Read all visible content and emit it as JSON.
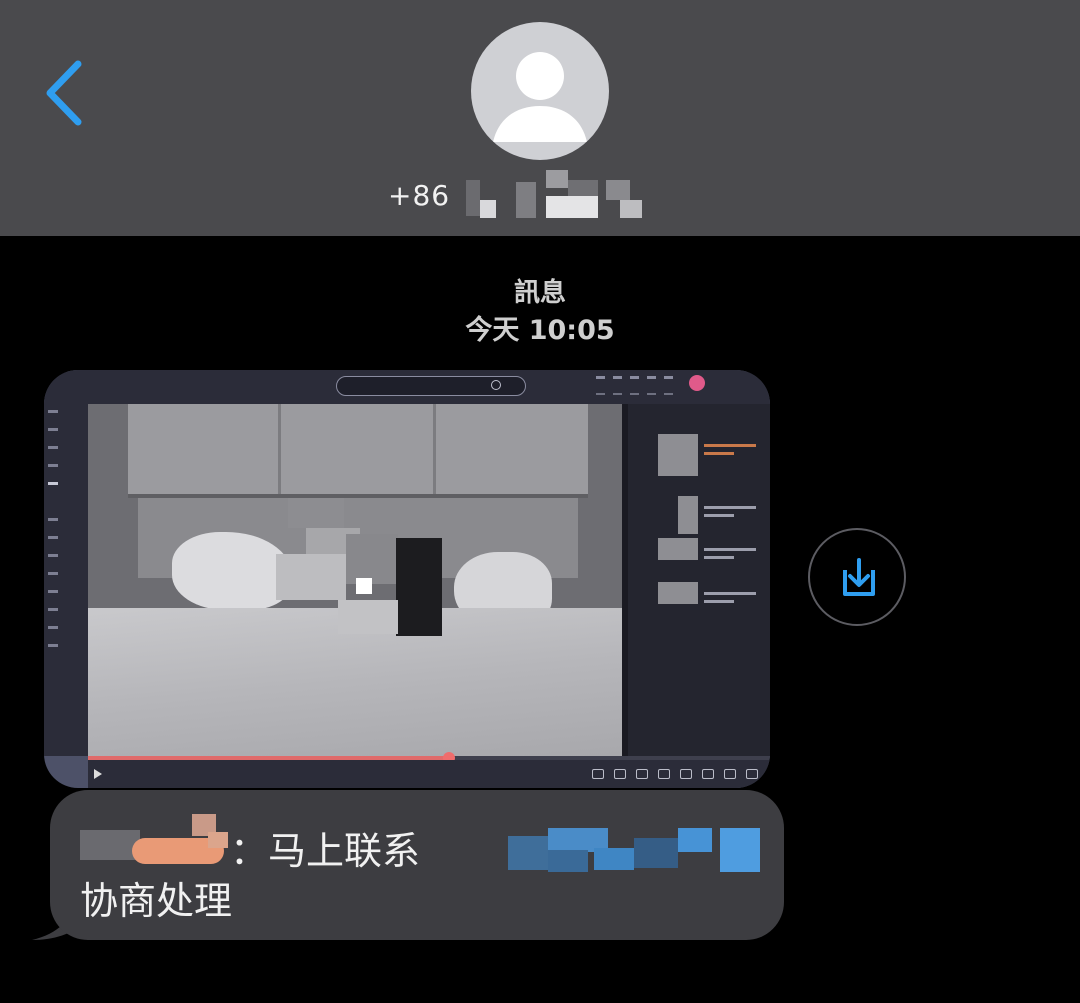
{
  "header": {
    "back_icon": "chevron-left-icon",
    "avatar_icon": "person-silhouette-icon",
    "phone_prefix": "+86",
    "accent_color": "#2f9ef0"
  },
  "thread": {
    "label": "訊息",
    "time": "今天 10:05"
  },
  "media_message": {
    "kind": "video-player-screenshot",
    "progress": 0.53,
    "save_icon": "download-icon"
  },
  "text_message": {
    "line1": "：马上联系",
    "line2": "协商处理"
  }
}
